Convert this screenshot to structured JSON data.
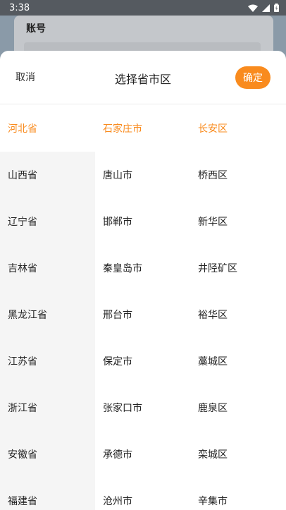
{
  "status_bar": {
    "time": "3:38"
  },
  "background": {
    "label": "账号"
  },
  "picker": {
    "cancel_label": "取消",
    "title": "选择省市区",
    "confirm_label": "确定",
    "accent_color": "#f98b1e",
    "provinces": [
      "河北省",
      "山西省",
      "辽宁省",
      "吉林省",
      "黑龙江省",
      "江苏省",
      "浙江省",
      "安徽省",
      "福建省"
    ],
    "cities": [
      "石家庄市",
      "唐山市",
      "邯郸市",
      "秦皇岛市",
      "邢台市",
      "保定市",
      "张家口市",
      "承德市",
      "沧州市"
    ],
    "districts": [
      "长安区",
      "桥西区",
      "新华区",
      "井陉矿区",
      "裕华区",
      "藁城区",
      "鹿泉区",
      "栾城区",
      "辛集市"
    ],
    "selected_province": "河北省",
    "selected_city": "石家庄市",
    "selected_district": "长安区"
  }
}
